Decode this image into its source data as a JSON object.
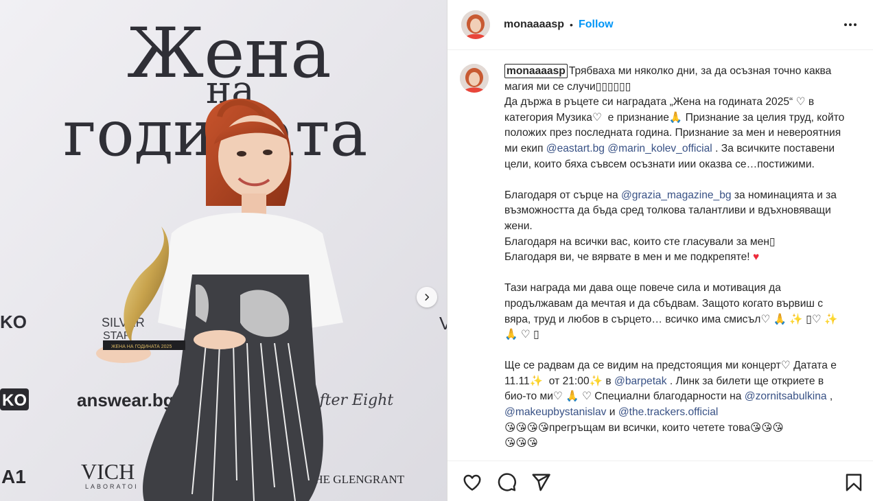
{
  "post": {
    "image_alt": "Photo of woman with red hair holding an award in front of a press wall",
    "image_text": {
      "title_line1": "Жена",
      "title_line2": "на",
      "title_line3": "годината",
      "year": "20",
      "sponsor_1": "SILVER",
      "sponsor_1b": "STAR",
      "sponsor_2": "answear.bg",
      "sponsor_3": "After Eight",
      "sponsor_4": "VICH",
      "sponsor_4b": "LABORATOI",
      "sponsor_5": "THE GLENGRANT",
      "sponsor_6": "KO",
      "sponsor_7": "A1",
      "award_plate": "ЖЕНА НА ГОДИНАТА 2025"
    }
  },
  "header": {
    "username": "monaaaasp",
    "separator": "•",
    "follow_label": "Follow"
  },
  "caption": {
    "username": "monaaaasp",
    "p1_a": "Трябваха ми няколко дни, за да осъзная точно каква магия ми се случи▯▯▯▯▯▯\nДа държа в ръцете си наградата „Жена на годината 2025“ ♡ в категория Музика♡  е признание🙏 Признание за целия труд, който положих през последната година. Признание за мен и невероятния ми екип ",
    "m1": "@eastart.bg",
    "sp1": " ",
    "m2": "@marin_kolev_official",
    "p1_b": " . За всичките поставени цели, които бяха съвсем осъзнати иии оказва се…постижими.\n\nБлагодаря от сърце на ",
    "m3": "@grazia_magazine_bg",
    "p2_a": " за номинацията и за възможността да бъда сред толкова талантливи и вдъхновяващи жени.\nБлагодаря на всички вас, които сте гласували за мен▯\nБлагодаря ви, че вярвате в мен и ме подкрепяте! ",
    "heart": "♥",
    "p3": "\n\nТази награда ми дава още повече сила и мотивация да продължавам да мечтая и да сбъдвам. Защото когато вървиш с вяра, труд и любов в сърцето… всичко има смисъл♡ 🙏 ✨ ▯♡ ✨ 🙏 ♡ ▯\n\nЩе се радвам да се видим на предстоящия ми концерт♡ Датата е 11.11✨  от 21:00✨ в ",
    "m4": "@barpetak",
    "p4": " . Линк за билети ще откриете в био-то ми♡ 🙏 ♡ Специални благодарности на ",
    "m5": "@zornitsabulkina",
    "p5": " , ",
    "m6": "@makeupbystanislav",
    "p6": " и ",
    "m7": "@the.trackers.official",
    "p7": "\n😘😘😘😘прегръщам ви всички, които четете това😘😘😘\n😘😘😘"
  },
  "icons": {
    "more": "more-horizontal-icon",
    "like": "heart-icon",
    "comment": "comment-icon",
    "share": "send-icon",
    "save": "bookmark-icon",
    "next": "chevron-right-icon"
  },
  "colors": {
    "link": "#385185",
    "follow": "#0095f6",
    "heart": "#ed2b3b",
    "text": "#262626"
  }
}
